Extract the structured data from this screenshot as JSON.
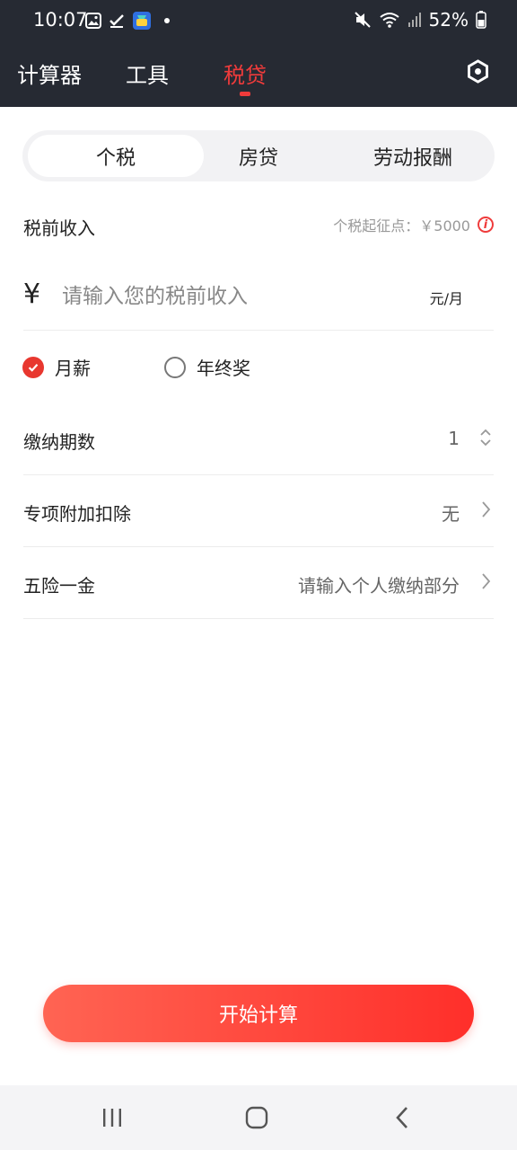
{
  "status_bar": {
    "time": "10:07",
    "battery": "52%"
  },
  "nav": {
    "tabs": [
      {
        "label": "计算器"
      },
      {
        "label": "工具"
      },
      {
        "label": "税贷",
        "active": true
      }
    ],
    "accent_color": "#ef3b3b"
  },
  "segment": {
    "items": [
      "个税",
      "房贷",
      "劳动报酬"
    ],
    "active": "个税"
  },
  "income": {
    "label": "税前收入",
    "threshold_hint": "个税起征点：￥5000",
    "currency_symbol": "¥",
    "placeholder": "请输入您的税前收入",
    "unit": "元/月"
  },
  "pay_type": {
    "options": [
      {
        "label": "月薪",
        "checked": true
      },
      {
        "label": "年终奖",
        "checked": false
      }
    ]
  },
  "rows": [
    {
      "name": "缴纳期数",
      "value": "1",
      "icon": "stepper-icon"
    },
    {
      "name": "专项附加扣除",
      "value": "无",
      "icon": "chevron-right-icon"
    },
    {
      "name": "五险一金",
      "value": "请输入个人缴纳部分",
      "icon": "chevron-right-icon"
    }
  ],
  "action": {
    "start_label": "开始计算"
  }
}
